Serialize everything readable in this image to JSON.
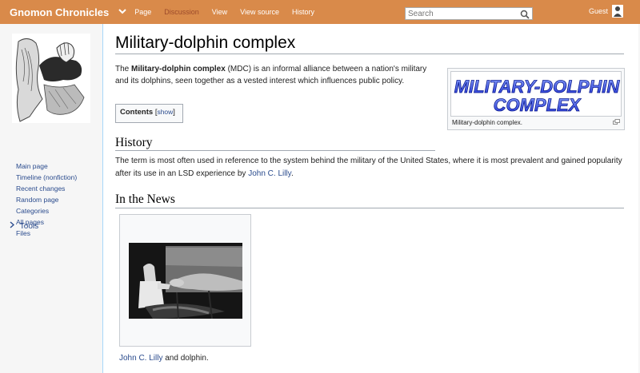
{
  "header": {
    "site_name": "Gnomon Chronicles",
    "nav": [
      "Page",
      "Discussion",
      "View",
      "View source",
      "History"
    ],
    "search_placeholder": "Search",
    "user": "Guest"
  },
  "sidebar": {
    "links": [
      "Main page",
      "Timeline (nonfiction)",
      "Recent changes",
      "Random page",
      "Categories",
      "All pages",
      "Files"
    ],
    "tools_label": "Tools"
  },
  "article": {
    "title": "Military-dolphin complex",
    "intro_pre": "The ",
    "intro_bold": "Military-dolphin complex",
    "intro_post": " (MDC) is an informal alliance between a nation's military and its dolphins, seen together as a vested interest which influences public policy.",
    "toc_label": "Contents",
    "toc_show": "show",
    "thumb_logo_line1": "MILITARY-DOLPHIN",
    "thumb_logo_line2": "COMPLEX",
    "thumb_caption": "Military-dolphin complex.",
    "history_heading": "History",
    "history_text": "The term is most often used in reference to the system behind the military of the United States, where it is most prevalent and gained popularity after its use in an LSD experience by ",
    "history_link": "John C. Lilly",
    "history_end": ".",
    "news_heading": "In the News",
    "news_caption_link": "John C. Lilly",
    "news_caption_text": " and dolphin."
  }
}
